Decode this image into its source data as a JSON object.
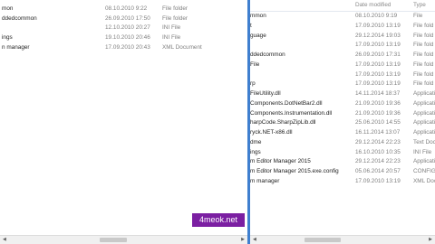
{
  "left": {
    "rows": [
      {
        "name": "mon",
        "date": "08.10.2010 9:22",
        "type": "File folder"
      },
      {
        "name": "ddedcommon",
        "date": "26.09.2010 17:50",
        "type": "File folder"
      },
      {
        "name": "",
        "date": "12.10.2010 20:27",
        "type": "INI File"
      },
      {
        "name": "ings",
        "date": "19.10.2010 20:46",
        "type": "INI File"
      },
      {
        "name": "n manager",
        "date": "17.09.2010 20:43",
        "type": "XML Document"
      }
    ]
  },
  "right": {
    "header": {
      "date": "Date modified",
      "type": "Type"
    },
    "rows": [
      {
        "name": "mmon",
        "date": "08.10.2010 9:19",
        "type": "File"
      },
      {
        "name": "t",
        "date": "17.09.2010 13:19",
        "type": "File fold"
      },
      {
        "name": "guage",
        "date": "29.12.2014 19:03",
        "type": "File fold"
      },
      {
        "name": "",
        "date": "17.09.2010 13:19",
        "type": "File fold"
      },
      {
        "name": "ddedcommon",
        "date": "26.09.2010 17:31",
        "type": "File fold"
      },
      {
        "name": "File",
        "date": "17.09.2010 13:19",
        "type": "File fold"
      },
      {
        "name": "",
        "date": "17.09.2010 13:19",
        "type": "File fold"
      },
      {
        "name": "rp",
        "date": "17.09.2010 13:19",
        "type": "File fold"
      },
      {
        "name": "FileUtility.dll",
        "date": "14.11.2014 18:37",
        "type": "Applicati"
      },
      {
        "name": "Components.DotNetBar2.dll",
        "date": "21.09.2010 19:36",
        "type": "Applicati"
      },
      {
        "name": "Components.Instrumentation.dll",
        "date": "21.09.2010 19:36",
        "type": "Applicati"
      },
      {
        "name": "harpCode.SharpZipLib.dll",
        "date": "25.06.2010 14:55",
        "type": "Applicati"
      },
      {
        "name": "ryck.NET-x86.dll",
        "date": "16.11.2014 13:07",
        "type": "Applicati"
      },
      {
        "name": "dme",
        "date": "29.12.2014 22:23",
        "type": "Text Docu"
      },
      {
        "name": "ings",
        "date": "16.10.2010 10:35",
        "type": "INI File"
      },
      {
        "name": "m Editor Manager 2015",
        "date": "29.12.2014 22:23",
        "type": "Applicati"
      },
      {
        "name": "m Editor Manager 2015.exe.config",
        "date": "05.06.2014 20:57",
        "type": "CONFIG F"
      },
      {
        "name": "m manager",
        "date": "17.09.2010 13:19",
        "type": "XML Docu"
      }
    ]
  },
  "watermark": "4meok.net",
  "colors": {
    "divider": "#3f7fcf",
    "badge": "#7b1fa2"
  }
}
